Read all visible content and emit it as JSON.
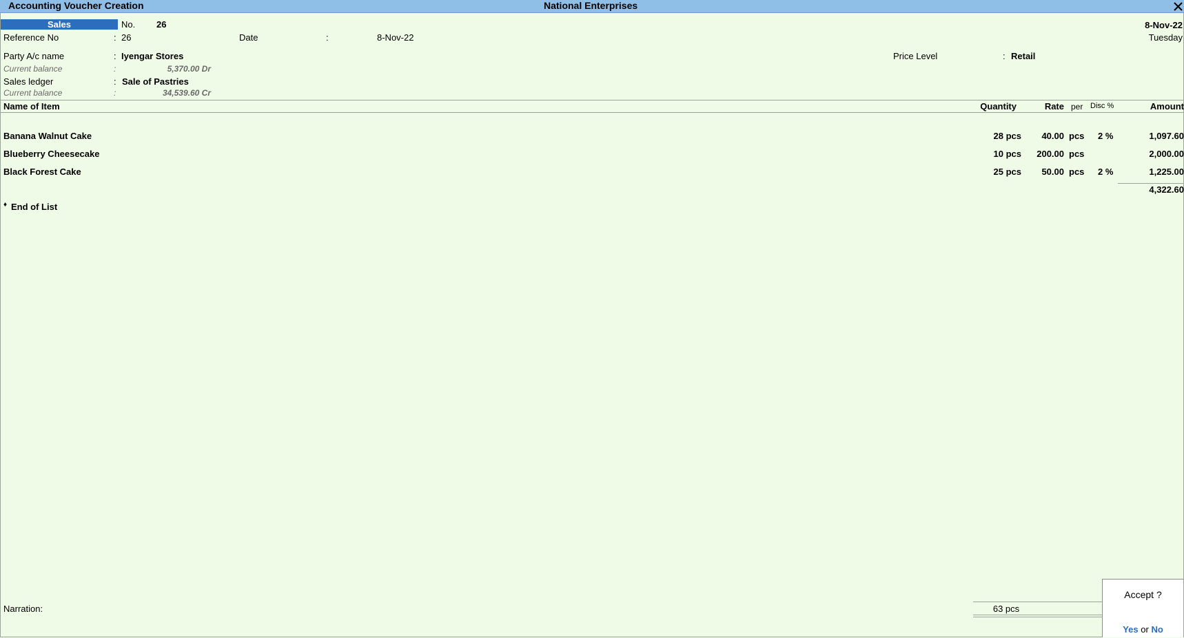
{
  "title_bar": {
    "title": "Accounting Voucher Creation",
    "company": "National Enterprises"
  },
  "voucher": {
    "type": "Sales",
    "no_label": "No.",
    "no_value": "26",
    "date_right": "8-Nov-22",
    "day_right": "Tuesday",
    "reference_label": "Reference No",
    "reference_value": "26",
    "date_label": "Date",
    "date_value": "8-Nov-22",
    "colon": ":"
  },
  "party": {
    "label": "Party A/c name",
    "value": "Iyengar Stores",
    "balance_label": "Current balance",
    "balance_value": "5,370.00 Dr"
  },
  "price_level": {
    "label": "Price Level",
    "value": "Retail"
  },
  "sales_ledger": {
    "label": "Sales ledger",
    "value": "Sale of Pastries",
    "balance_label": "Current balance",
    "balance_value": "34,539.60 Cr"
  },
  "table": {
    "headers": {
      "item": "Name of Item",
      "quantity": "Quantity",
      "rate": "Rate",
      "per": "per",
      "disc": "Disc %",
      "amount": "Amount"
    },
    "rows": [
      {
        "item": "Banana Walnut Cake",
        "quantity": "28 pcs",
        "rate": "40.00",
        "per": "pcs",
        "disc": "2 %",
        "amount": "1,097.60"
      },
      {
        "item": "Blueberry Cheesecake",
        "quantity": "10 pcs",
        "rate": "200.00",
        "per": "pcs",
        "disc": "",
        "amount": "2,000.00"
      },
      {
        "item": "Black Forest Cake",
        "quantity": "25 pcs",
        "rate": "50.00",
        "per": "pcs",
        "disc": "2 %",
        "amount": "1,225.00"
      }
    ],
    "subtotal": "4,322.60",
    "end_of_list": "End of List",
    "end_marker": "♦"
  },
  "footer": {
    "narration_label": "Narration:",
    "total_quantity": "63 pcs"
  },
  "accept_dialog": {
    "question": "Accept ?",
    "yes": "Yes",
    "or": "or",
    "no": "No"
  },
  "icons": {
    "close": "close-icon"
  },
  "colors": {
    "title_bar": "#8fbfe6",
    "background": "#f0fbe7",
    "highlight": "#2c6ebd"
  }
}
